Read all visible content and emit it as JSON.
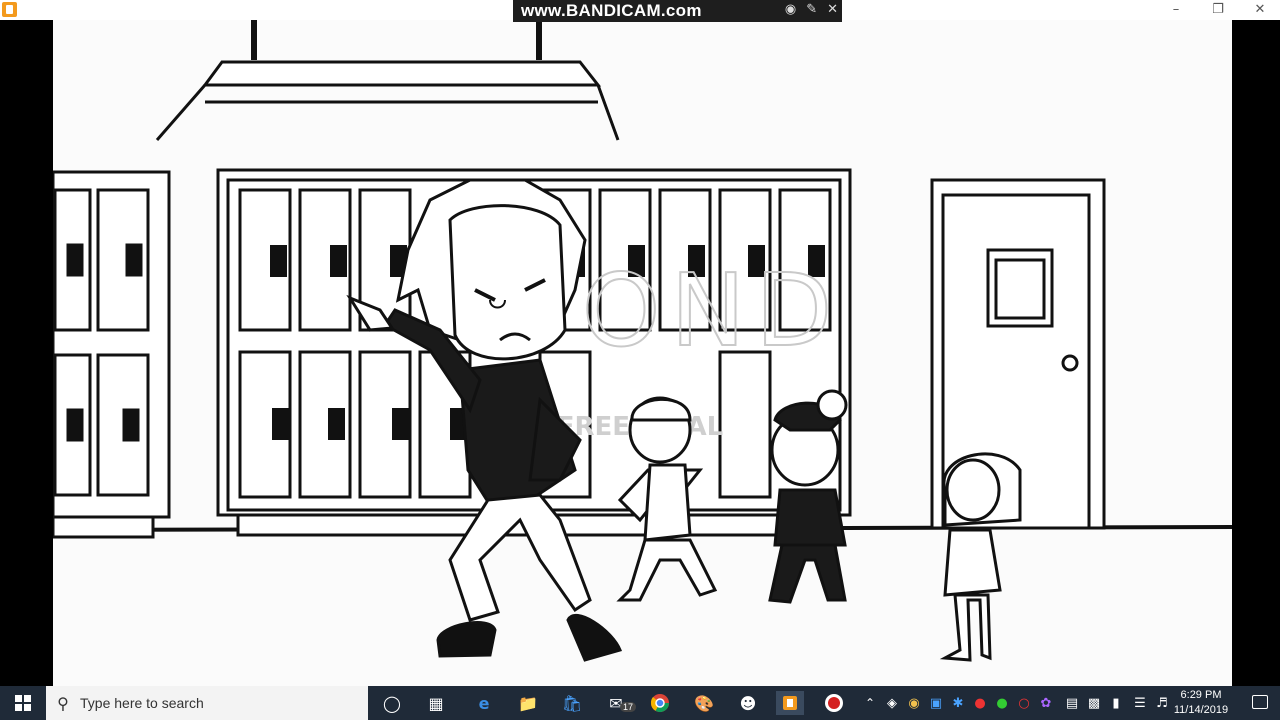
{
  "recorder": {
    "watermark": "www.BANDICAM.com"
  },
  "video": {
    "watermark_logo": "VYOND",
    "watermark_sub": "FREE TRIAL"
  },
  "taskbar": {
    "search_placeholder": "Type here to search",
    "clock_time": "6:29 PM",
    "clock_date": "11/14/2019",
    "mail_badge": "17"
  }
}
